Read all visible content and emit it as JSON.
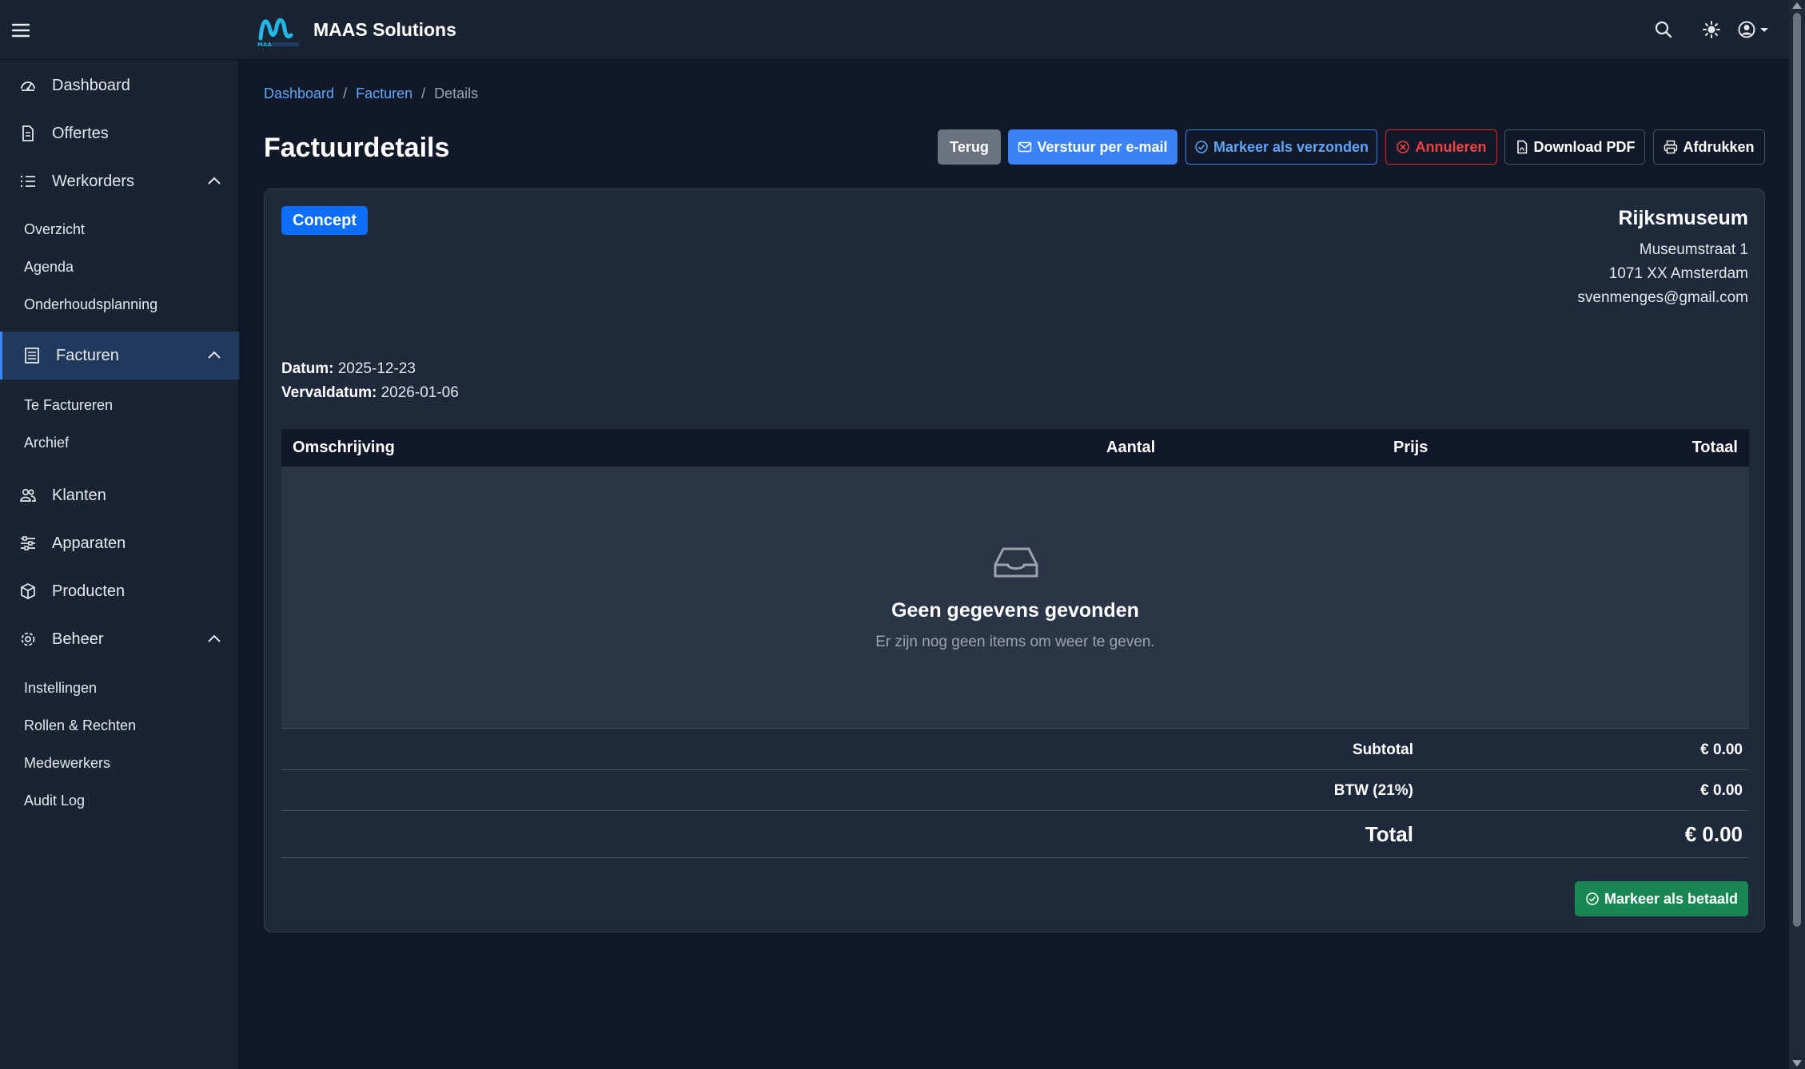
{
  "app": {
    "brand": "MAAS Solutions",
    "logo_text": "MAAS"
  },
  "topbar": {
    "menu_icon": "hamburger-icon",
    "search_icon": "search-icon",
    "theme_icon": "sun-icon",
    "user_icon": "user-circle-icon"
  },
  "sidebar": {
    "items": [
      {
        "label": "Dashboard",
        "icon": "speedometer-icon"
      },
      {
        "label": "Offertes",
        "icon": "document-icon"
      },
      {
        "label": "Werkorders",
        "icon": "list-icon",
        "expanded": true,
        "children": [
          "Overzicht",
          "Agenda",
          "Onderhoudsplanning"
        ]
      },
      {
        "label": "Facturen",
        "icon": "invoice-icon",
        "expanded": true,
        "active": true,
        "children": [
          "Te Factureren",
          "Archief"
        ]
      },
      {
        "label": "Klanten",
        "icon": "people-icon"
      },
      {
        "label": "Apparaten",
        "icon": "device-icon"
      },
      {
        "label": "Producten",
        "icon": "box-icon"
      },
      {
        "label": "Beheer",
        "icon": "gear-icon",
        "expanded": true,
        "children": [
          "Instellingen",
          "Rollen & Rechten",
          "Medewerkers",
          "Audit Log"
        ]
      }
    ]
  },
  "breadcrumb": {
    "items": [
      "Dashboard",
      "Facturen"
    ],
    "current": "Details",
    "separator": "/"
  },
  "page": {
    "title": "Factuurdetails"
  },
  "actions": {
    "back": "Terug",
    "email": "Verstuur per e-mail",
    "mark_sent": "Markeer als verzonden",
    "cancel": "Annuleren",
    "download_pdf": "Download PDF",
    "print": "Afdrukken"
  },
  "invoice": {
    "status": "Concept",
    "customer": {
      "name": "Rijksmuseum",
      "address": "Museumstraat 1",
      "city": "1071 XX Amsterdam",
      "email": "svenmenges@gmail.com"
    },
    "date_label": "Datum:",
    "date": "2025-12-23",
    "due_label": "Vervaldatum:",
    "due": "2026-01-06"
  },
  "table": {
    "headers": [
      "Omschrijving",
      "Aantal",
      "Prijs",
      "Totaal"
    ],
    "rows": [],
    "empty_title": "Geen gegevens gevonden",
    "empty_text": "Er zijn nog geen items om weer te geven."
  },
  "totals": {
    "subtotal_label": "Subtotal",
    "subtotal": "€ 0.00",
    "vat_label": "BTW (21%)",
    "vat": "€ 0.00",
    "total_label": "Total",
    "total": "€ 0.00"
  },
  "footer_action": {
    "mark_paid": "Markeer als betaald"
  },
  "colors": {
    "background": "#111827",
    "panel": "#1a2332",
    "card": "#1e293b",
    "primary": "#3b82f6",
    "danger": "#dc2626",
    "success": "#198754",
    "badge": "#0d6efd"
  }
}
